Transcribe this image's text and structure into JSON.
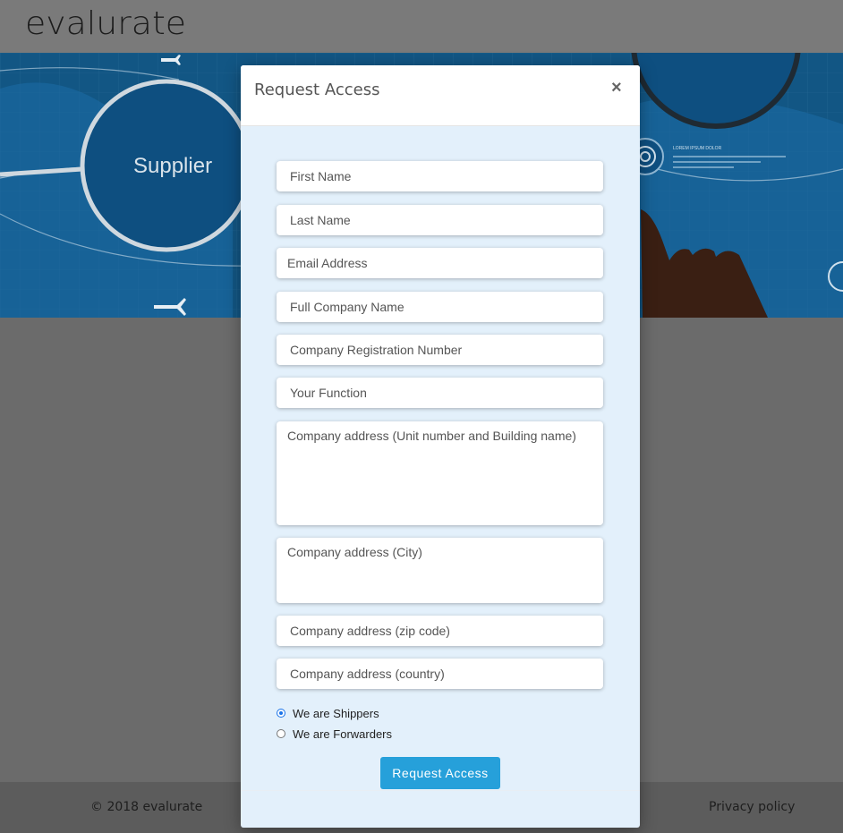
{
  "brand": {
    "logo": "evalurate"
  },
  "hero": {
    "supplier_label": "Supplier",
    "tag_text": "LOREM IPSUM DOLOR"
  },
  "modal": {
    "title": "Request Access",
    "close_symbol": "×",
    "fields": {
      "first_name": "First Name",
      "last_name": "Last Name",
      "email": "Email Address",
      "company_name": "Full Company Name",
      "registration_number": "Company Registration Number",
      "function": "Your Function",
      "address_unit": "Company address (Unit number and Building name)",
      "address_city": "Company address (City)",
      "address_zip": "Company address (zip code)",
      "address_country": "Company address (country)"
    },
    "radios": {
      "shippers": {
        "label": "We are Shippers",
        "checked": true
      },
      "forwarders": {
        "label": "We are Forwarders",
        "checked": false
      }
    },
    "submit_label": "Request Access"
  },
  "footer": {
    "copyright": "© 2018 evalurate",
    "privacy": "Privacy policy"
  },
  "colors": {
    "accent": "#26a0da",
    "modal_body": "#e3f0fb",
    "hero": "#0d3a5a"
  }
}
